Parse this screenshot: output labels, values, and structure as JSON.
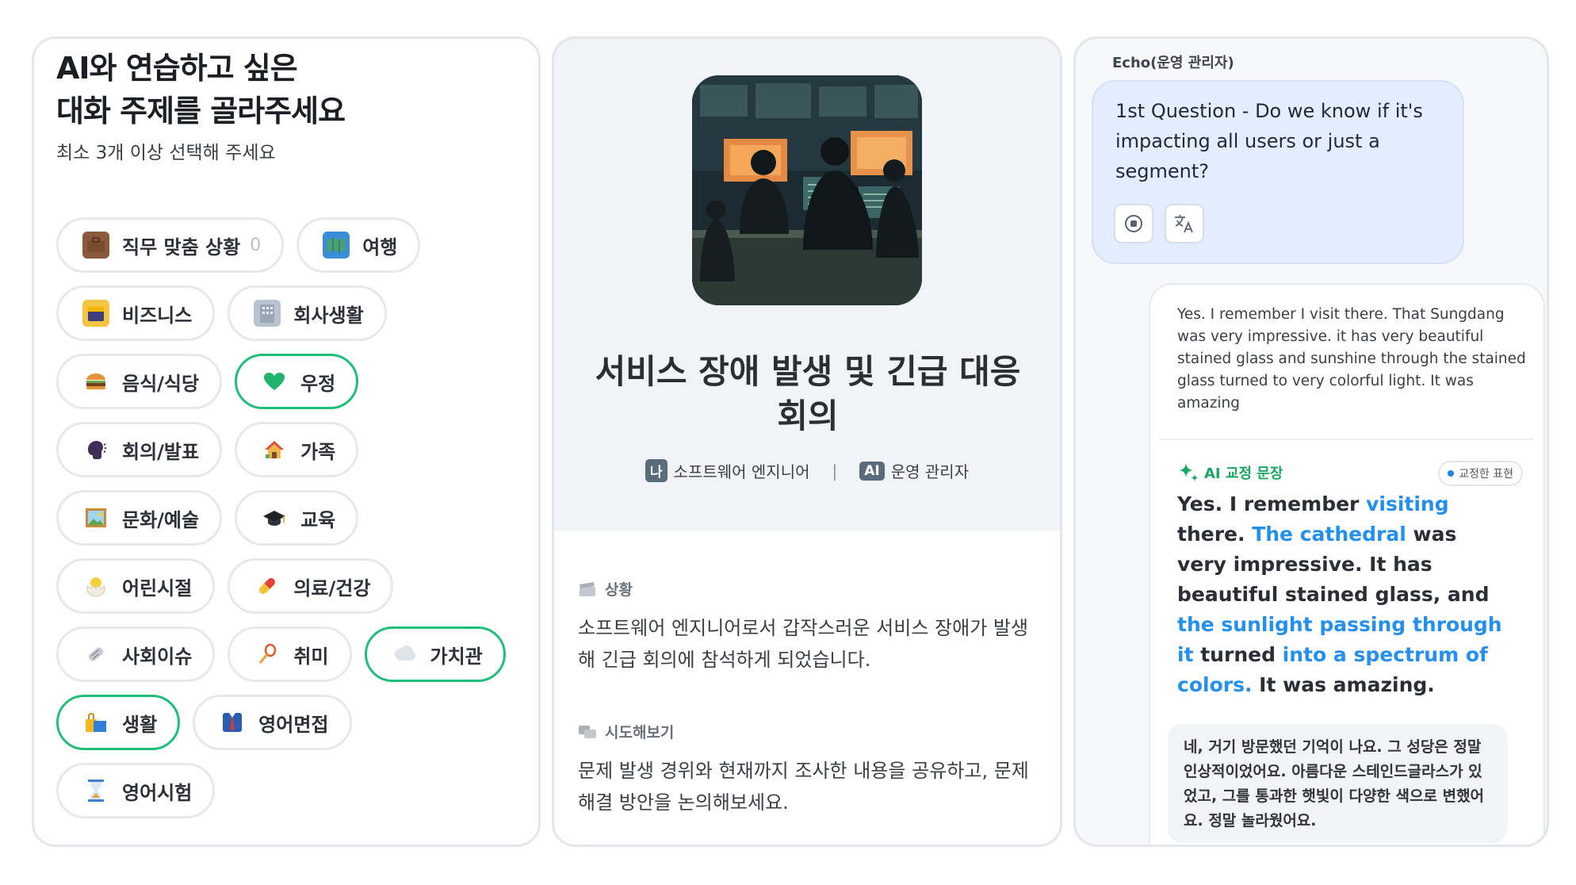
{
  "topic_picker": {
    "title": "AI와 연습하고 싶은\n대화 주제를 골라주세요",
    "subtitle": "최소 3개 이상 선택해 주세요",
    "chips": [
      {
        "label": "직무 맞춤 상황",
        "count": "0",
        "icon": "briefcase-icon",
        "selected": false
      },
      {
        "label": "여행",
        "icon": "map-icon",
        "selected": false
      },
      {
        "label": "비즈니스",
        "icon": "calendar-icon",
        "selected": false
      },
      {
        "label": "회사생활",
        "icon": "office-building-icon",
        "selected": false
      },
      {
        "label": "음식/식당",
        "icon": "burger-icon",
        "selected": false
      },
      {
        "label": "우정",
        "icon": "green-heart-icon",
        "selected": true
      },
      {
        "label": "회의/발표",
        "icon": "speaking-head-icon",
        "selected": false
      },
      {
        "label": "가족",
        "icon": "house-icon",
        "selected": false
      },
      {
        "label": "문화/예술",
        "icon": "framed-picture-icon",
        "selected": false
      },
      {
        "label": "교육",
        "icon": "graduation-cap-icon",
        "selected": false
      },
      {
        "label": "어린시절",
        "icon": "hatching-chick-icon",
        "selected": false
      },
      {
        "label": "의료/건강",
        "icon": "pill-icon",
        "selected": false
      },
      {
        "label": "사회이슈",
        "icon": "newspaper-icon",
        "selected": false
      },
      {
        "label": "취미",
        "icon": "badminton-icon",
        "selected": false
      },
      {
        "label": "가치관",
        "icon": "thought-cloud-icon",
        "selected": true
      },
      {
        "label": "생활",
        "icon": "shopping-bags-icon",
        "selected": true
      },
      {
        "label": "영어면접",
        "icon": "suit-tie-icon",
        "selected": false
      },
      {
        "label": "영어시험",
        "icon": "hourglass-icon",
        "selected": false
      }
    ]
  },
  "scenario": {
    "title": "서비스 장애 발생 및 긴급 대응 회의",
    "me_badge": "나",
    "me_role": "소프트웨어 엔지니어",
    "separator": "|",
    "ai_badge": "AI",
    "ai_role": "운영 관리자",
    "situation_label": "상황",
    "situation_text": "소프트웨어 엔지니어로서 갑작스러운 서비스 장애가 발생해 긴급 회의에 참석하게 되었습니다.",
    "try_label": "시도해보기",
    "try_text": "문제 발생 경위와 현재까지 조사한 내용을 공유하고, 문제 해결 방안을 논의해보세요."
  },
  "chat": {
    "speaker": "Echo(운영 관리자)",
    "question": "1st Question - Do we know if it's impacting all users or just a segment?",
    "answer": "Yes. I remember I visit there. That Sungdang was very impressive. it has very beautiful stained glass and sunshine through the stained glass turned to very colorful light. It was amazing",
    "correction_label": "AI 교정 문장",
    "legend_label": "교정한 표현",
    "correction_segments": [
      {
        "text": "Yes. I remember ",
        "fix": false
      },
      {
        "text": "visiting",
        "fix": true
      },
      {
        "text": " there. ",
        "fix": false
      },
      {
        "text": "The cathedral",
        "fix": true
      },
      {
        "text": " was very impressive. It has beautiful stained glass, and ",
        "fix": false
      },
      {
        "text": "the sunlight passing through it",
        "fix": true
      },
      {
        "text": " turned ",
        "fix": false
      },
      {
        "text": "into a spectrum of colors.",
        "fix": true
      },
      {
        "text": " It was amazing.",
        "fix": false
      }
    ],
    "translation": "네, 거기 방문했던 기억이 나요. 그 성당은 정말 인상적이었어요. 아름다운 스테인드글라스가 있었고, 그를 통과한 햇빛이 다양한 색으로 변했어요. 정말 놀라웠어요.",
    "colors": {
      "bubble": "#e2edfd",
      "correction_green": "#19a862",
      "fix_blue": "#2390f0"
    }
  }
}
